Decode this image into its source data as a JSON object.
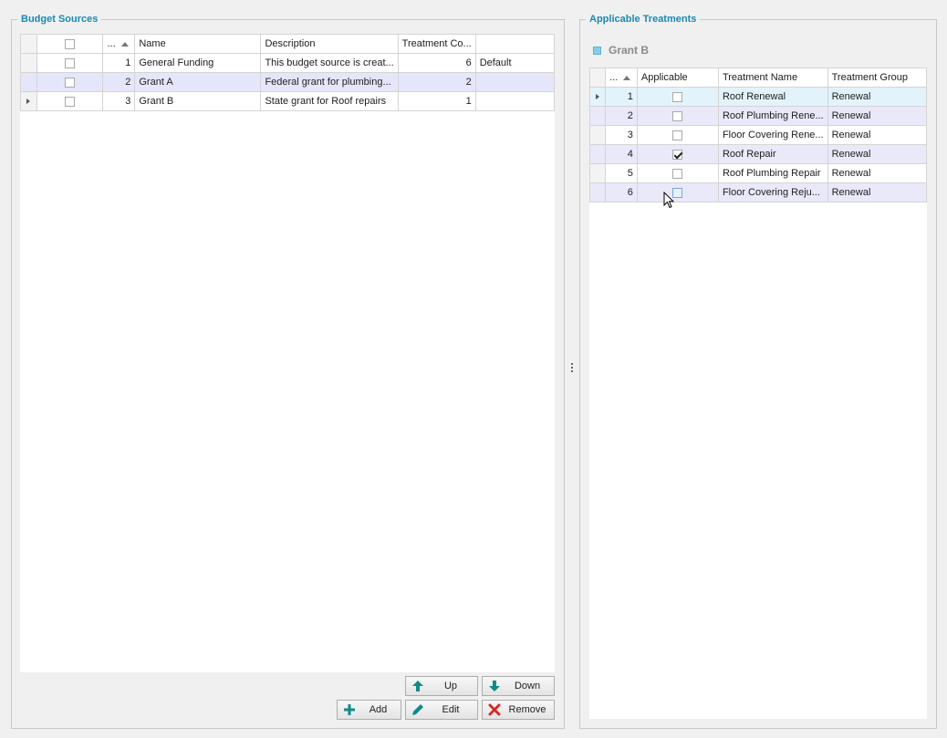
{
  "budget": {
    "title": "Budget Sources",
    "columns": [
      "...",
      "Name",
      "Description",
      "Treatment Co...",
      ""
    ],
    "rows": [
      {
        "id": "1",
        "name": "General Funding",
        "description": "This budget source is creat...",
        "count": "6",
        "extra": "Default"
      },
      {
        "id": "2",
        "name": "Grant A",
        "description": "Federal grant for plumbing...",
        "count": "2",
        "extra": ""
      },
      {
        "id": "3",
        "name": "Grant B",
        "description": "State grant for Roof repairs",
        "count": "1",
        "extra": ""
      }
    ],
    "buttons": {
      "up": "Up",
      "down": "Down",
      "add": "Add",
      "edit": "Edit",
      "remove": "Remove"
    }
  },
  "treatments": {
    "title": "Applicable Treatments",
    "selected_source": "Grant B",
    "columns": [
      "...",
      "Applicable",
      "Treatment Name",
      "Treatment Group"
    ],
    "rows": [
      {
        "id": "1",
        "applicable": false,
        "name": "Roof Renewal",
        "group": "Renewal"
      },
      {
        "id": "2",
        "applicable": false,
        "name": "Roof Plumbing Rene...",
        "group": "Renewal"
      },
      {
        "id": "3",
        "applicable": false,
        "name": "Floor Covering Rene...",
        "group": "Renewal"
      },
      {
        "id": "4",
        "applicable": true,
        "name": "Roof Repair",
        "group": "Renewal"
      },
      {
        "id": "5",
        "applicable": false,
        "name": "Roof Plumbing Repair",
        "group": "Renewal"
      },
      {
        "id": "6",
        "applicable": false,
        "name": "Floor Covering Reju...",
        "group": "Renewal"
      }
    ]
  },
  "colors": {
    "accent": "#1a8ab0",
    "selected_row": "#e6e6fb",
    "cyan_row": "#e3f3fb"
  }
}
